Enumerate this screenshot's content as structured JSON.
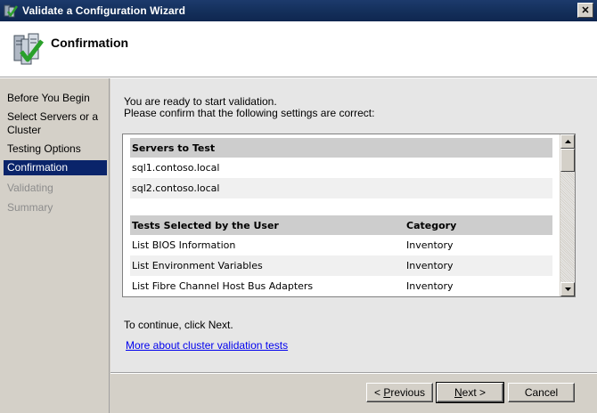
{
  "window": {
    "title": "Validate a Configuration Wizard",
    "close_glyph": "✕"
  },
  "header": {
    "title": "Confirmation"
  },
  "nav": {
    "items": [
      {
        "label": "Before You Begin",
        "state": "normal"
      },
      {
        "label": "Select Servers or a Cluster",
        "state": "normal"
      },
      {
        "label": "Testing Options",
        "state": "normal"
      },
      {
        "label": "Confirmation",
        "state": "active"
      },
      {
        "label": "Validating",
        "state": "disabled"
      },
      {
        "label": "Summary",
        "state": "disabled"
      }
    ]
  },
  "content": {
    "intro_line1": "You are ready to start validation.",
    "intro_line2": "Please confirm that the following settings are correct:",
    "servers_header": "Servers to Test",
    "servers": [
      "sql1.contoso.local",
      "sql2.contoso.local"
    ],
    "tests_header": "Tests Selected by the User",
    "category_header": "Category",
    "tests": [
      {
        "name": "List BIOS Information",
        "category": "Inventory"
      },
      {
        "name": "List Environment Variables",
        "category": "Inventory"
      },
      {
        "name": "List Fibre Channel Host Bus Adapters",
        "category": "Inventory"
      }
    ],
    "continue_text": "To continue, click Next.",
    "more_link": "More about cluster validation tests"
  },
  "buttons": {
    "previous_prefix": "< ",
    "previous_ul": "P",
    "previous_rest": "revious",
    "next_ul": "N",
    "next_rest": "ext >",
    "cancel": "Cancel"
  },
  "colors": {
    "selection": "#0a246a",
    "link": "#0000ee",
    "titlebar": "#14305c"
  },
  "icons": {
    "app": "wizard-server-check-icon",
    "header": "server-check-icon"
  }
}
